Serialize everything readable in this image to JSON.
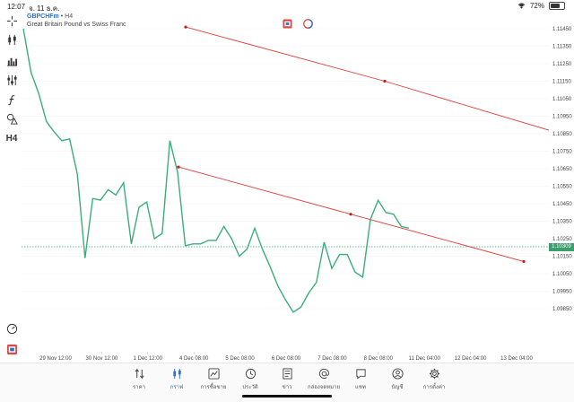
{
  "status": {
    "time": "12:07",
    "date": "จ. 11 ธ.ค.",
    "battery": "72%"
  },
  "symbol": {
    "name": "GBPCHFm",
    "timeframe": "H4",
    "description": "Great Britain Pound vs Swiss Franc"
  },
  "toolbar": {
    "timeframe_label": "H4"
  },
  "colors": {
    "series": "#3aae7a",
    "trendline": "#e03a3a",
    "accent": "#2c6fd1",
    "bid_line": "#3aa275"
  },
  "current_price": "1.10309",
  "chart_data": {
    "type": "line",
    "price_ticks": [
      "1.11450",
      "1.11350",
      "1.11250",
      "1.11150",
      "1.11050",
      "1.10950",
      "1.10850",
      "1.10750",
      "1.10650",
      "1.10550",
      "1.10450",
      "1.10350",
      "1.10250",
      "1.10150",
      "1.10050",
      "1.09950",
      "1.09850"
    ],
    "time_ticks": [
      "29 Nov 12:00",
      "30 Nov 12:00",
      "1 Dec 12:00",
      "4 Dec 08:00",
      "5 Dec 08:00",
      "6 Dec 08:00",
      "7 Dec 08:00",
      "8 Dec 08:00",
      "11 Dec 04:00",
      "12 Dec 04:00",
      "13 Dec 04:00"
    ],
    "series": [
      {
        "values": [
          1.1145,
          1.112,
          1.1108,
          1.1092,
          1.1086,
          1.1081,
          1.1082,
          1.1062,
          1.1014,
          1.1048,
          1.1047,
          1.1053,
          1.105,
          1.1057,
          1.1022,
          1.1043,
          1.1046,
          1.1025,
          1.1028,
          1.1081,
          1.1063,
          1.1021,
          1.1022,
          1.1022,
          1.1024,
          1.1024,
          1.1032,
          1.1025,
          1.1015,
          1.1019,
          1.1031,
          1.1019,
          1.1009,
          1.0998,
          1.099,
          1.0983,
          1.0986,
          1.0994,
          1.1,
          1.1023,
          1.1008,
          1.1016,
          1.1016,
          1.1006,
          1.1003,
          1.1036,
          1.1047,
          1.104,
          1.1039,
          1.1032,
          1.1031
        ]
      }
    ],
    "trendlines": [
      {
        "points": [
          1.1146,
          1.1115,
          1.1087
        ]
      },
      {
        "points": [
          1.1066,
          1.1039,
          1.1012
        ]
      }
    ]
  },
  "nav": [
    {
      "label": "ราคา",
      "icon": "quotes-icon"
    },
    {
      "label": "กราฟ",
      "icon": "chart-icon",
      "active": true
    },
    {
      "label": "การซื้อขาย",
      "icon": "trade-icon"
    },
    {
      "label": "ประวัติ",
      "icon": "history-icon"
    },
    {
      "label": "ข่าว",
      "icon": "news-icon"
    },
    {
      "label": "กล่องจดหมาย",
      "icon": "mailbox-icon"
    },
    {
      "label": "แชท",
      "icon": "chat-icon"
    },
    {
      "label": "บัญชี",
      "icon": "account-icon"
    },
    {
      "label": "การตั้งค่า",
      "icon": "settings-icon"
    }
  ]
}
